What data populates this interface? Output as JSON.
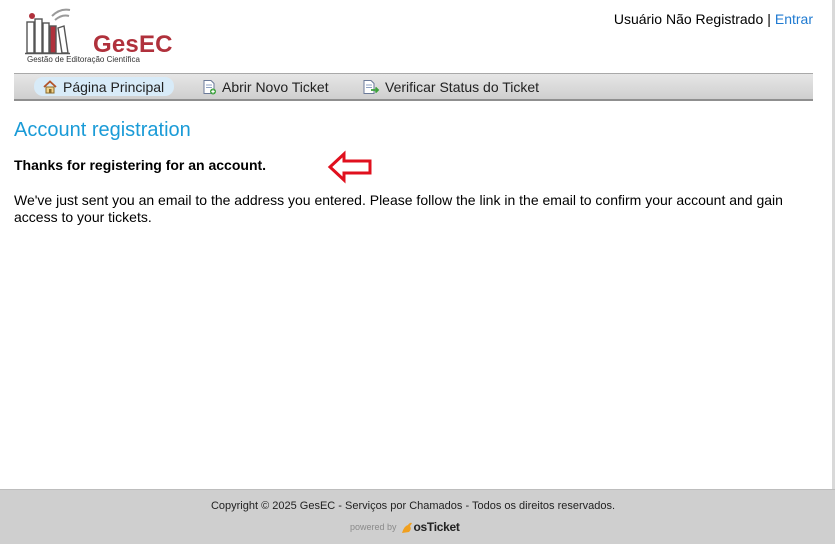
{
  "header": {
    "logo_name": "GesEC",
    "logo_tagline": "Gestão de Editoração Científica",
    "user_status": "Usuário Não Registrado",
    "separator": "|",
    "login_link": "Entrar"
  },
  "nav": {
    "items": [
      {
        "label": "Página Principal",
        "icon": "home-icon",
        "active": true
      },
      {
        "label": "Abrir Novo Ticket",
        "icon": "new-ticket-icon",
        "active": false
      },
      {
        "label": "Verificar Status do Ticket",
        "icon": "ticket-status-icon",
        "active": false
      }
    ]
  },
  "main": {
    "title": "Account registration",
    "thanks": "Thanks for registering for an account.",
    "message": "We've just sent you an email to the address you entered. Please follow the link in the email to confirm your account and gain access to your tickets."
  },
  "footer": {
    "copyright": "Copyright © 2025 GesEC - Serviços por Chamados - Todos os direitos reservados.",
    "powered_by": "powered by",
    "brand": "osTicket"
  },
  "colors": {
    "accent": "#1a9bd7",
    "brand": "#b0313c",
    "link": "#1f7ad1",
    "annotation_arrow": "#e0101e"
  }
}
